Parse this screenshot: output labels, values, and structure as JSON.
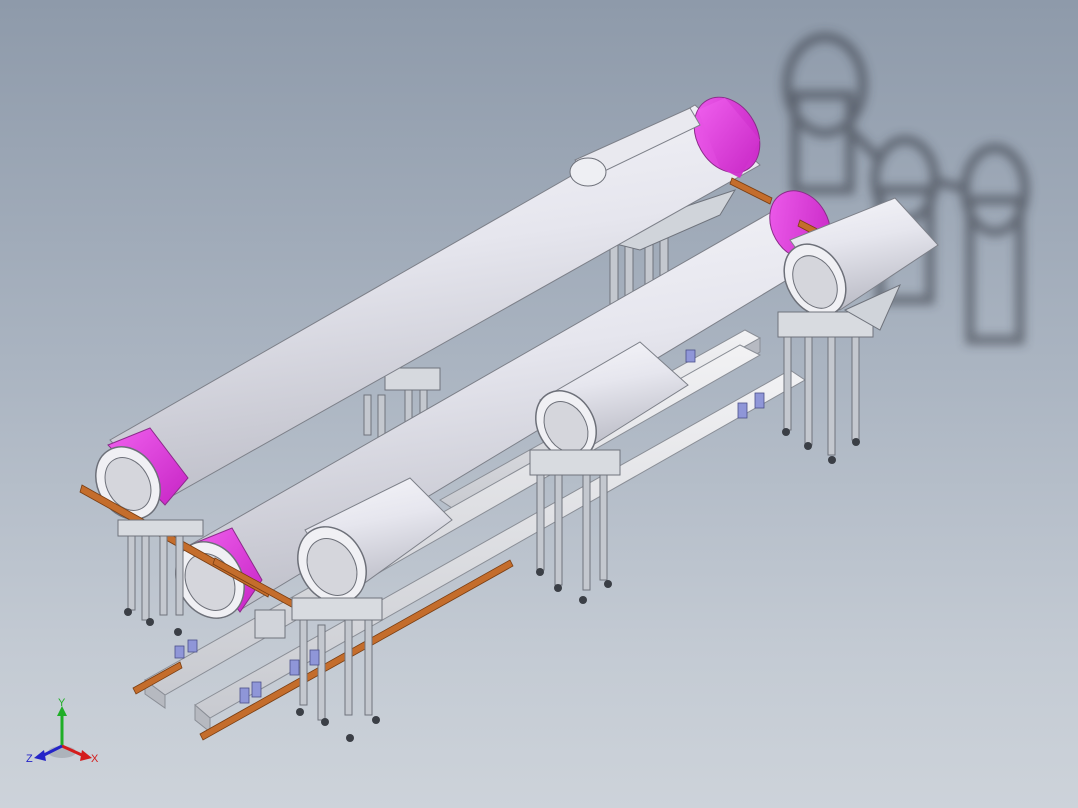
{
  "viewport": {
    "background_top": "#8e9aaa",
    "background_bottom": "#cdd3da"
  },
  "model": {
    "description_colors": {
      "pipe_body": "#e4e6ec",
      "end_cap": "#e43ee0",
      "rail_copper": "#c06a2a",
      "frame_metal": "#b8bcc4",
      "clamp_blue": "#8f96d8"
    }
  },
  "triad": {
    "x_label": "X",
    "y_label": "Y",
    "z_label": "Z",
    "x_color": "#d41c1c",
    "y_color": "#1fae27",
    "z_color": "#2424c8"
  }
}
